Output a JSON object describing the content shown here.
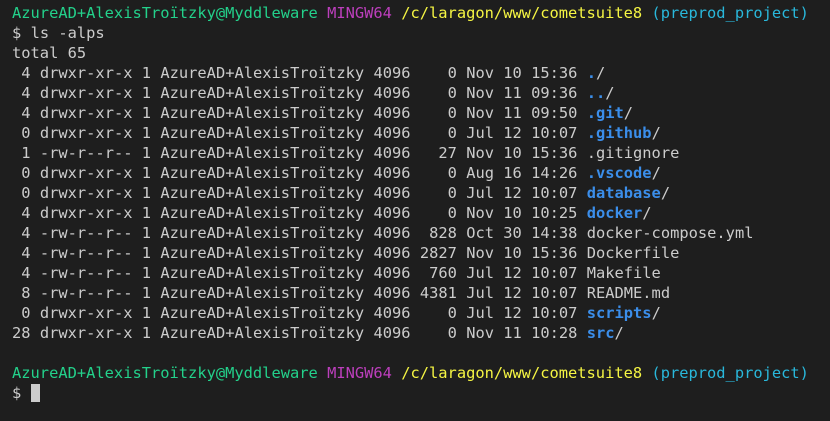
{
  "colors": {
    "background": "#1e1e1e",
    "foreground": "#cccccc",
    "user_host": "#23d18b",
    "shell": "#bc3fbc",
    "path": "#f5f543",
    "branch": "#29b8db",
    "directory": "#3b8eea"
  },
  "prompt": {
    "user_host": "AzureAD+AlexisTroïtzky@Myddleware",
    "shell": "MINGW64",
    "path": "/c/laragon/www/cometsuite8",
    "branch": "(preprod_project)",
    "symbol": "$"
  },
  "command": "ls -alps",
  "total": "total 65",
  "listing": [
    {
      "blocks": " 4",
      "perms": "drwxr-xr-x",
      "links": "1",
      "owner": "AzureAD+AlexisTroïtzky",
      "group": "4096",
      "size": "   0",
      "date": "Nov 10 15:36",
      "name": ".",
      "suffix": "/",
      "is_dir": true
    },
    {
      "blocks": " 4",
      "perms": "drwxr-xr-x",
      "links": "1",
      "owner": "AzureAD+AlexisTroïtzky",
      "group": "4096",
      "size": "   0",
      "date": "Nov 11 09:36",
      "name": "..",
      "suffix": "/",
      "is_dir": true
    },
    {
      "blocks": " 4",
      "perms": "drwxr-xr-x",
      "links": "1",
      "owner": "AzureAD+AlexisTroïtzky",
      "group": "4096",
      "size": "   0",
      "date": "Nov 11 09:50",
      "name": ".git",
      "suffix": "/",
      "is_dir": true
    },
    {
      "blocks": " 0",
      "perms": "drwxr-xr-x",
      "links": "1",
      "owner": "AzureAD+AlexisTroïtzky",
      "group": "4096",
      "size": "   0",
      "date": "Jul 12 10:07",
      "name": ".github",
      "suffix": "/",
      "is_dir": true
    },
    {
      "blocks": " 1",
      "perms": "-rw-r--r--",
      "links": "1",
      "owner": "AzureAD+AlexisTroïtzky",
      "group": "4096",
      "size": "  27",
      "date": "Nov 10 15:36",
      "name": ".gitignore",
      "suffix": "",
      "is_dir": false
    },
    {
      "blocks": " 0",
      "perms": "drwxr-xr-x",
      "links": "1",
      "owner": "AzureAD+AlexisTroïtzky",
      "group": "4096",
      "size": "   0",
      "date": "Aug 16 14:26",
      "name": ".vscode",
      "suffix": "/",
      "is_dir": true
    },
    {
      "blocks": " 0",
      "perms": "drwxr-xr-x",
      "links": "1",
      "owner": "AzureAD+AlexisTroïtzky",
      "group": "4096",
      "size": "   0",
      "date": "Jul 12 10:07",
      "name": "database",
      "suffix": "/",
      "is_dir": true
    },
    {
      "blocks": " 4",
      "perms": "drwxr-xr-x",
      "links": "1",
      "owner": "AzureAD+AlexisTroïtzky",
      "group": "4096",
      "size": "   0",
      "date": "Nov 10 10:25",
      "name": "docker",
      "suffix": "/",
      "is_dir": true
    },
    {
      "blocks": " 4",
      "perms": "-rw-r--r--",
      "links": "1",
      "owner": "AzureAD+AlexisTroïtzky",
      "group": "4096",
      "size": " 828",
      "date": "Oct 30 14:38",
      "name": "docker-compose.yml",
      "suffix": "",
      "is_dir": false
    },
    {
      "blocks": " 4",
      "perms": "-rw-r--r--",
      "links": "1",
      "owner": "AzureAD+AlexisTroïtzky",
      "group": "4096",
      "size": "2827",
      "date": "Nov 10 15:36",
      "name": "Dockerfile",
      "suffix": "",
      "is_dir": false
    },
    {
      "blocks": " 4",
      "perms": "-rw-r--r--",
      "links": "1",
      "owner": "AzureAD+AlexisTroïtzky",
      "group": "4096",
      "size": " 760",
      "date": "Jul 12 10:07",
      "name": "Makefile",
      "suffix": "",
      "is_dir": false
    },
    {
      "blocks": " 8",
      "perms": "-rw-r--r--",
      "links": "1",
      "owner": "AzureAD+AlexisTroïtzky",
      "group": "4096",
      "size": "4381",
      "date": "Jul 12 10:07",
      "name": "README.md",
      "suffix": "",
      "is_dir": false
    },
    {
      "blocks": " 0",
      "perms": "drwxr-xr-x",
      "links": "1",
      "owner": "AzureAD+AlexisTroïtzky",
      "group": "4096",
      "size": "   0",
      "date": "Jul 12 10:07",
      "name": "scripts",
      "suffix": "/",
      "is_dir": true
    },
    {
      "blocks": "28",
      "perms": "drwxr-xr-x",
      "links": "1",
      "owner": "AzureAD+AlexisTroïtzky",
      "group": "4096",
      "size": "   0",
      "date": "Nov 11 10:28",
      "name": "src",
      "suffix": "/",
      "is_dir": true
    }
  ]
}
